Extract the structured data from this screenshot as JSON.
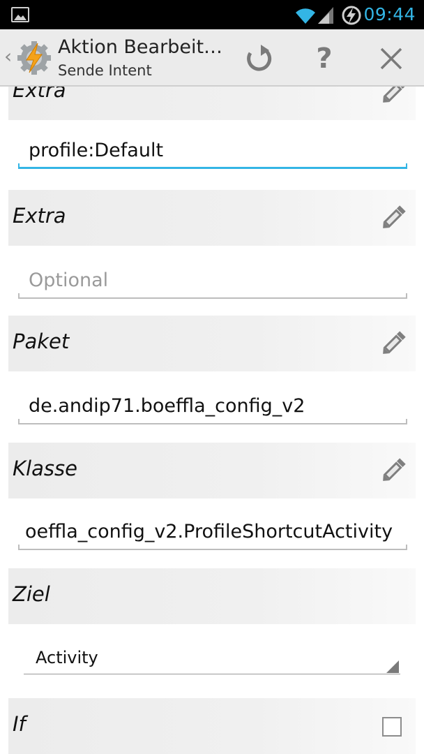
{
  "status_bar": {
    "time": "09:44",
    "icons": [
      "image-notification-icon",
      "wifi-icon",
      "signal-icon",
      "battery-charging-icon"
    ]
  },
  "action_bar": {
    "title": "Aktion Bearbeit…",
    "subtitle": "Sende Intent",
    "actions": [
      "reset-icon",
      "help-icon",
      "close-icon"
    ],
    "help_glyph": "?"
  },
  "form": {
    "extra1": {
      "label": "Extra",
      "value": "profile:Default"
    },
    "extra2": {
      "label": "Extra",
      "value": "",
      "placeholder": "Optional"
    },
    "paket": {
      "label": "Paket",
      "value": "de.andip71.boeffla_config_v2"
    },
    "klasse": {
      "label": "Klasse",
      "value": "oeffla_config_v2.ProfileShortcutActivity"
    },
    "ziel": {
      "label": "Ziel",
      "selected": "Activity"
    },
    "if": {
      "label": "If",
      "checked": false
    }
  },
  "colors": {
    "accent": "#33b5e5",
    "action_bar_bg": "#ebebeb",
    "section_bg": "#ececec"
  }
}
